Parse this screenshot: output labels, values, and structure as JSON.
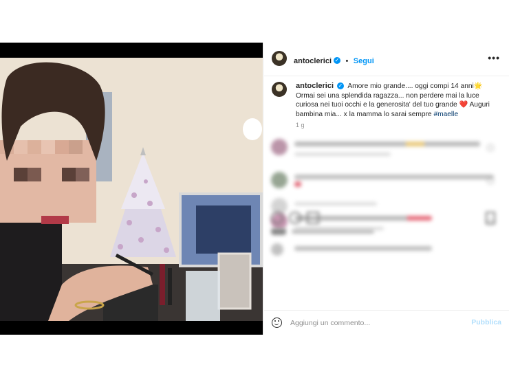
{
  "post": {
    "username": "antoclerici",
    "follow_label": "Segui",
    "more_label": "•••",
    "verified_glyph": "✓",
    "caption_text": "Amore mio grande.... oggi compi 14 anni🌟 Ormai sei una splendida ragazza... non perdere mai la luce curiosa nei tuoi occhi e la generosita' del tuo grande ❤️ Auguri bambina mia... x la mamma lo sarai sempre ",
    "hashtag": "#maelle",
    "age": "1 g"
  },
  "comment_bar": {
    "emoji_icon": "smiley-icon",
    "placeholder": "Aggiungi un commento...",
    "publish_label": "Pubblica"
  },
  "colors": {
    "accent": "#0095f6",
    "publish_disabled": "#b2dffc",
    "hashtag": "#00376b"
  }
}
